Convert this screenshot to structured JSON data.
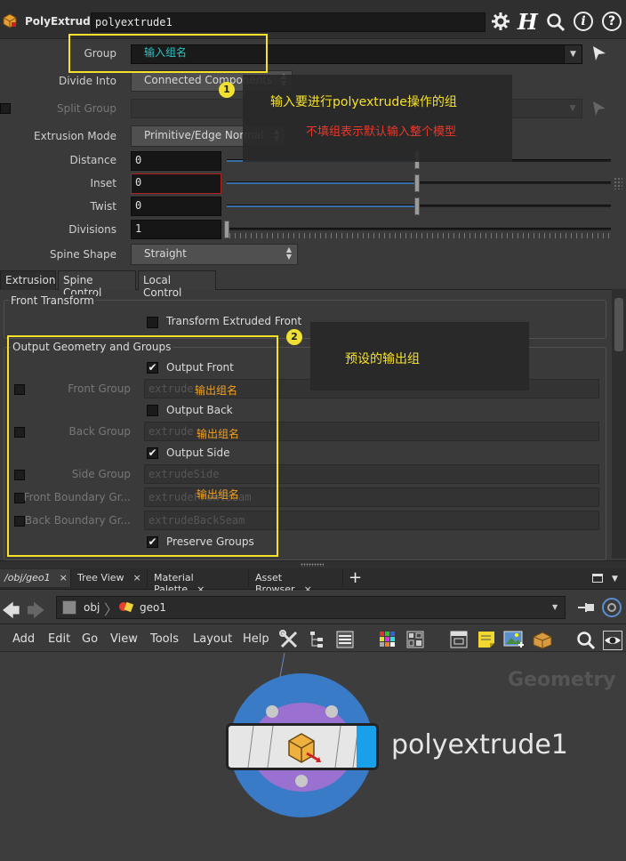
{
  "header": {
    "node_type": "PolyExtrude",
    "node_name": "polyextrude1"
  },
  "params": {
    "group_label": "Group",
    "group_value": "输入组名",
    "divide_label": "Divide Into",
    "divide_value": "Connected Components",
    "split_label": "Split Group",
    "mode_label": "Extrusion Mode",
    "mode_value": "Primitive/Edge Normal",
    "distance_label": "Distance",
    "distance_value": "0",
    "inset_label": "Inset",
    "inset_value": "0",
    "twist_label": "Twist",
    "twist_value": "0",
    "divisions_label": "Divisions",
    "divisions_value": "1",
    "spine_label": "Spine Shape",
    "spine_value": "Straight"
  },
  "tabs": [
    "Extrusion",
    "Spine Control",
    "Local Control"
  ],
  "front_transform": {
    "title": "Front Transform",
    "check_label": "Transform Extruded Front"
  },
  "output": {
    "title": "Output Geometry and Groups",
    "output_front": "Output Front",
    "front_group": "Front Group",
    "front_group_value": "extrude",
    "output_back": "Output Back",
    "back_group": "Back Group",
    "back_group_value": "extrude",
    "output_side": "Output Side",
    "side_group": "Side Group",
    "side_group_value": "extrudeSide",
    "front_boundary": "Front Boundary Gr...",
    "front_boundary_value": "extrudeFrontSeam",
    "back_boundary": "Back Boundary Gr...",
    "back_boundary_value": "extrudeBackSeam",
    "preserve": "Preserve Groups"
  },
  "annotations": {
    "badge1": "1",
    "badge2": "2",
    "callout1_line1": "输入要进行polyextrude操作的组",
    "callout1_line2": "不填组表示默认输入整个模型",
    "callout2": "预设的输出组",
    "out_name": "输出组名"
  },
  "pane_tabs": [
    "/obj/geo1",
    "Tree View",
    "Material Palette",
    "Asset Browser"
  ],
  "path": {
    "root": "obj",
    "child": "geo1"
  },
  "network_menu": [
    "Add",
    "Edit",
    "Go",
    "View",
    "Tools",
    "Layout",
    "Help"
  ],
  "network": {
    "watermark": "Geometry",
    "node_label": "polyextrude1"
  },
  "colors": {
    "annotation_yellow": "#f5e12a",
    "annotation_red": "#e8382c",
    "annotation_orange": "#f0a020",
    "annotation_cyan": "#29c4c4",
    "slider_blue": "#3a6ea8",
    "node_ring": "#3a7bc8",
    "node_purple": "#9a70d0"
  }
}
